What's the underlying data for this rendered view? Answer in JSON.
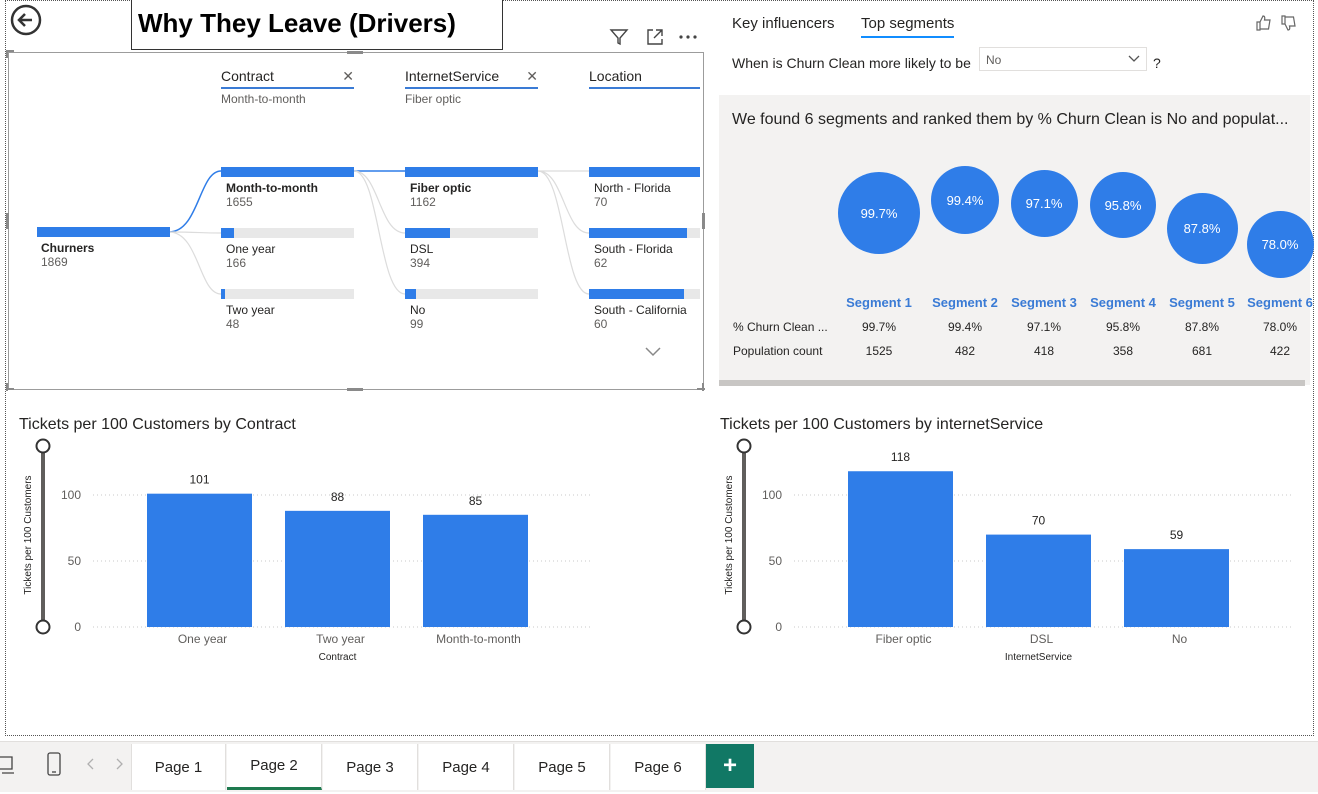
{
  "title": "Why They Leave (Drivers)",
  "tree": {
    "root": {
      "label": "Churners",
      "value": "1869"
    },
    "levels": [
      {
        "name": "Contract",
        "sub": "Month-to-month",
        "has_close": true
      },
      {
        "name": "InternetService",
        "sub": "Fiber optic",
        "has_close": true
      },
      {
        "name": "Location",
        "sub": "",
        "has_close": false
      }
    ],
    "contract_nodes": [
      {
        "label": "Month-to-month",
        "value": "1655",
        "fill": 1.0,
        "bold": true
      },
      {
        "label": "One year",
        "value": "166",
        "fill": 0.1,
        "bold": false
      },
      {
        "label": "Two year",
        "value": "48",
        "fill": 0.03,
        "bold": false
      }
    ],
    "internet_nodes": [
      {
        "label": "Fiber optic",
        "value": "1162",
        "fill": 1.0,
        "bold": true
      },
      {
        "label": "DSL",
        "value": "394",
        "fill": 0.34,
        "bold": false
      },
      {
        "label": "No",
        "value": "99",
        "fill": 0.085,
        "bold": false
      }
    ],
    "location_nodes": [
      {
        "label": "North - Florida",
        "value": "70",
        "fill": 1.0
      },
      {
        "label": "South - Florida",
        "value": "62",
        "fill": 0.88
      },
      {
        "label": "South - California",
        "value": "60",
        "fill": 0.86
      }
    ]
  },
  "segments": {
    "tabs": {
      "key_influencers": "Key influencers",
      "top_segments": "Top segments"
    },
    "question_prefix": "When is Churn Clean more likely to be",
    "question_suffix": "?",
    "dropdown_value": "No",
    "found_text": "We found 6 segments and ranked them by % Churn Clean is No and populat...",
    "items": [
      {
        "name": "Segment 1",
        "pct": "99.7%",
        "pop": "1525",
        "pop_num": 1525
      },
      {
        "name": "Segment 2",
        "pct": "99.4%",
        "pop": "482",
        "pop_num": 482
      },
      {
        "name": "Segment 3",
        "pct": "97.1%",
        "pop": "418",
        "pop_num": 418
      },
      {
        "name": "Segment 4",
        "pct": "95.8%",
        "pop": "358",
        "pop_num": 358
      },
      {
        "name": "Segment 5",
        "pct": "87.8%",
        "pop": "681",
        "pop_num": 681
      },
      {
        "name": "Segment 6",
        "pct": "78.0%",
        "pop": "422",
        "pop_num": 422
      }
    ],
    "row_labels": {
      "pct": "% Churn Clean ...",
      "pop": "Population count"
    }
  },
  "chart_data": [
    {
      "type": "bar",
      "title": "Tickets per 100 Customers by Contract",
      "xlabel": "Contract",
      "ylabel": "Tickets per 100 Customers",
      "categories": [
        "One year",
        "Two year",
        "Month-to-month"
      ],
      "values": [
        101,
        88,
        85
      ],
      "yticks": [
        "0",
        "50",
        "100"
      ],
      "ylim": [
        0,
        120
      ]
    },
    {
      "type": "bar",
      "title": "Tickets per 100 Customers by internetService",
      "xlabel": "InternetService",
      "ylabel": "Tickets per 100 Customers",
      "categories": [
        "Fiber optic",
        "DSL",
        "No"
      ],
      "values": [
        118,
        70,
        59
      ],
      "yticks": [
        "0",
        "50",
        "100"
      ],
      "ylim": [
        0,
        120
      ]
    }
  ],
  "pages": [
    "Page 1",
    "Page 2",
    "Page 3",
    "Page 4",
    "Page 5",
    "Page 6"
  ],
  "active_page": "Page 2",
  "add_page_label": "+",
  "colors": {
    "bar": "#2f7de8",
    "accent": "#118dff",
    "tab_green": "#117865"
  }
}
